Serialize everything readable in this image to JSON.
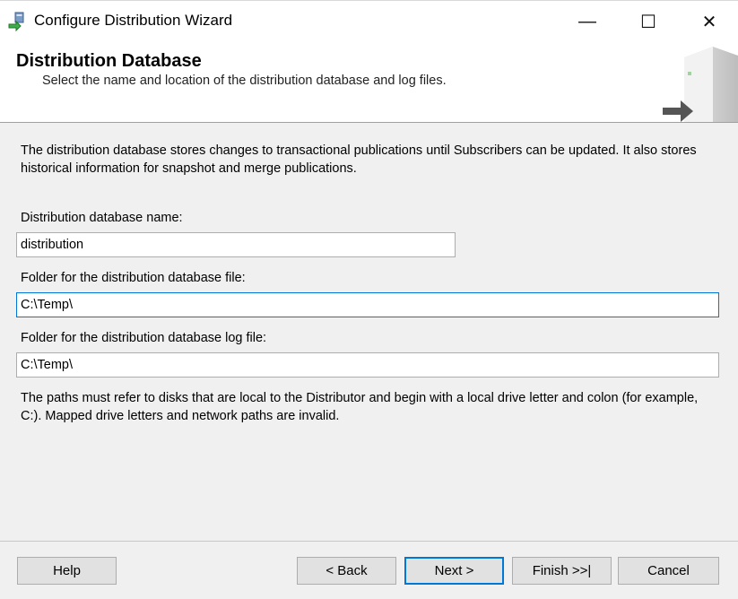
{
  "window": {
    "title": "Configure Distribution Wizard",
    "minimize_glyph": "—",
    "maximize_glyph": "☐",
    "close_glyph": "✕"
  },
  "header": {
    "title": "Distribution Database",
    "subtitle": "Select the name and location of the distribution database and log files.",
    "art_icon": "server-icon"
  },
  "description": "The distribution database stores changes to transactional publications until Subscribers can be updated. It also stores historical information for snapshot and merge publications.",
  "fields": {
    "db_name": {
      "label": "Distribution database name:",
      "value": "distribution"
    },
    "db_folder": {
      "label": "Folder for the distribution database file:",
      "value": "C:\\Temp\\"
    },
    "log_folder": {
      "label": "Folder for the distribution database log file:",
      "value": "C:\\Temp\\"
    }
  },
  "note": "The paths must refer to disks that are local to the Distributor and begin with a local drive letter and colon (for example, C:). Mapped drive letters and network paths are invalid.",
  "buttons": {
    "help": "Help",
    "back": "< Back",
    "next": "Next >",
    "finish": "Finish >>|",
    "cancel": "Cancel"
  },
  "colors": {
    "accent": "#0078d7",
    "window_bg": "#f0f0f0",
    "header_bg": "#ffffff"
  }
}
